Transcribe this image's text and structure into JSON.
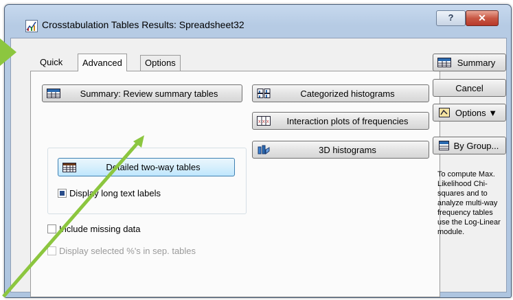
{
  "window": {
    "title": "Crosstabulation Tables Results: Spreadsheet32",
    "help_label": "?",
    "close_label": "✕"
  },
  "tabs": [
    {
      "label": "Quick"
    },
    {
      "label": "Advanced"
    },
    {
      "label": "Options"
    }
  ],
  "panel": {
    "summary_button": "Summary:  Review summary tables",
    "categorized_histograms": "Categorized histograms",
    "interaction_plots": "Interaction plots of frequencies",
    "histograms_3d": "3D histograms",
    "detailed_tables": "Detailed two-way tables",
    "display_long_labels": "Display long text labels",
    "display_long_labels_checked": true,
    "include_missing": "Include missing data",
    "include_missing_checked": false,
    "display_selected": "Display selected %'s in sep. tables",
    "display_selected_checked": false
  },
  "side": {
    "summary": "Summary",
    "cancel": "Cancel",
    "options": "Options ▼",
    "by_group": "By Group...",
    "hint": "To compute Max. Likelihood Chi-squares and to analyze multi-way frequency tables use the Log-Linear module."
  },
  "colors": {
    "annotation_arrow": "#8cc63f"
  }
}
